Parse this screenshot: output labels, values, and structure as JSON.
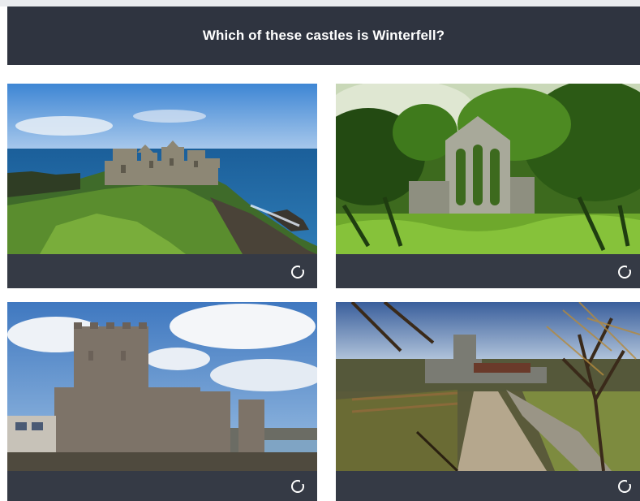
{
  "question": {
    "text": "Which of these castles is Winterfell?"
  },
  "options": [
    {
      "image": "cliff-castle-ruins-by-sea",
      "selected": false
    },
    {
      "image": "ivy-covered-abbey-ruins",
      "selected": false
    },
    {
      "image": "stone-keep-castle-by-harbour",
      "selected": false
    },
    {
      "image": "farm-road-with-tower",
      "selected": false
    }
  ],
  "colors": {
    "bar": "#2f3440",
    "card": "#353a45",
    "text": "#ffffff",
    "background": "#ffffff"
  }
}
